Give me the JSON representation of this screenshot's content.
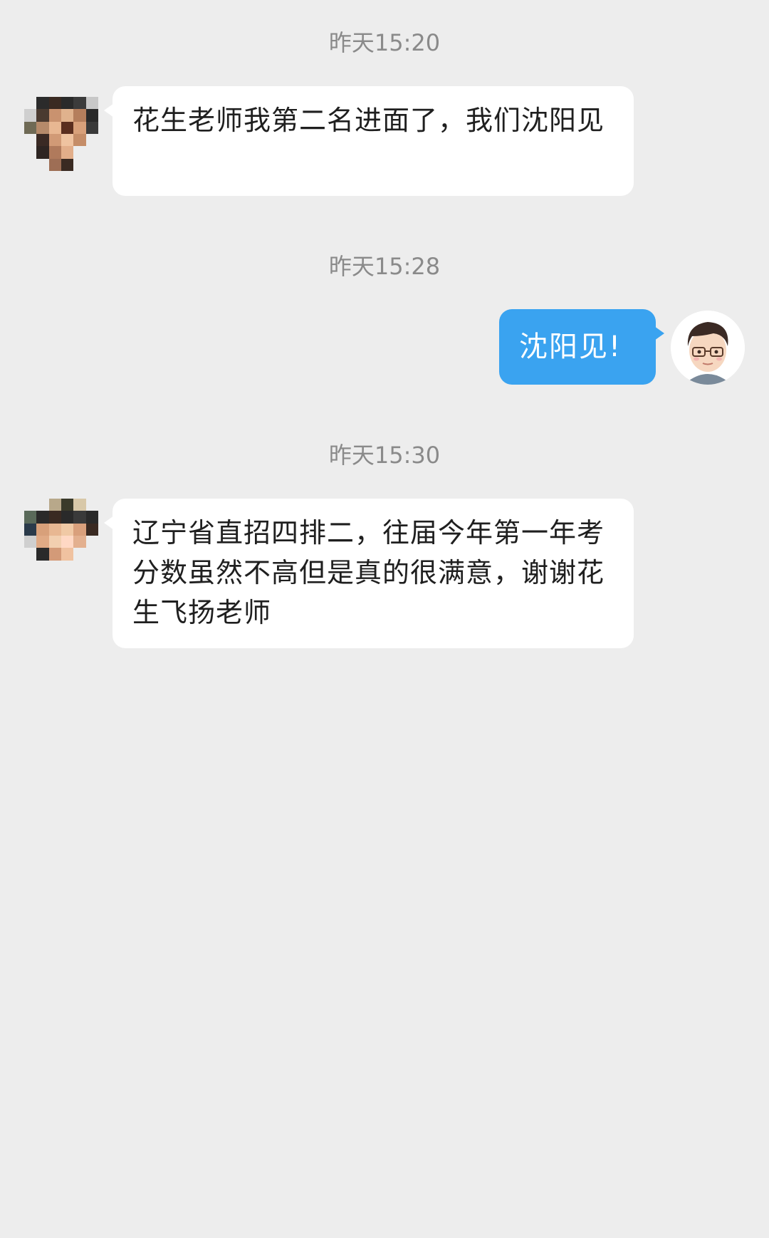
{
  "messages": [
    {
      "timestamp": "昨天15:20",
      "sender": "student",
      "text": "花生老师我第二名进面了，我们沈阳见"
    },
    {
      "timestamp": "昨天15:28",
      "sender": "teacher",
      "text": "沈阳见!"
    },
    {
      "timestamp": "昨天15:30",
      "sender": "student",
      "text": "辽宁省直招四排二，往届今年第一年考分数虽然不高但是真的很满意，谢谢花生飞扬老师"
    }
  ],
  "colors": {
    "background": "#ededed",
    "incoming_bubble": "#ffffff",
    "outgoing_bubble": "#3aa3f0",
    "timestamp_text": "#8a8a8a"
  },
  "icons": {
    "student_avatar": "pixelated-avatar-icon",
    "teacher_avatar": "cartoon-teacher-avatar-icon"
  }
}
